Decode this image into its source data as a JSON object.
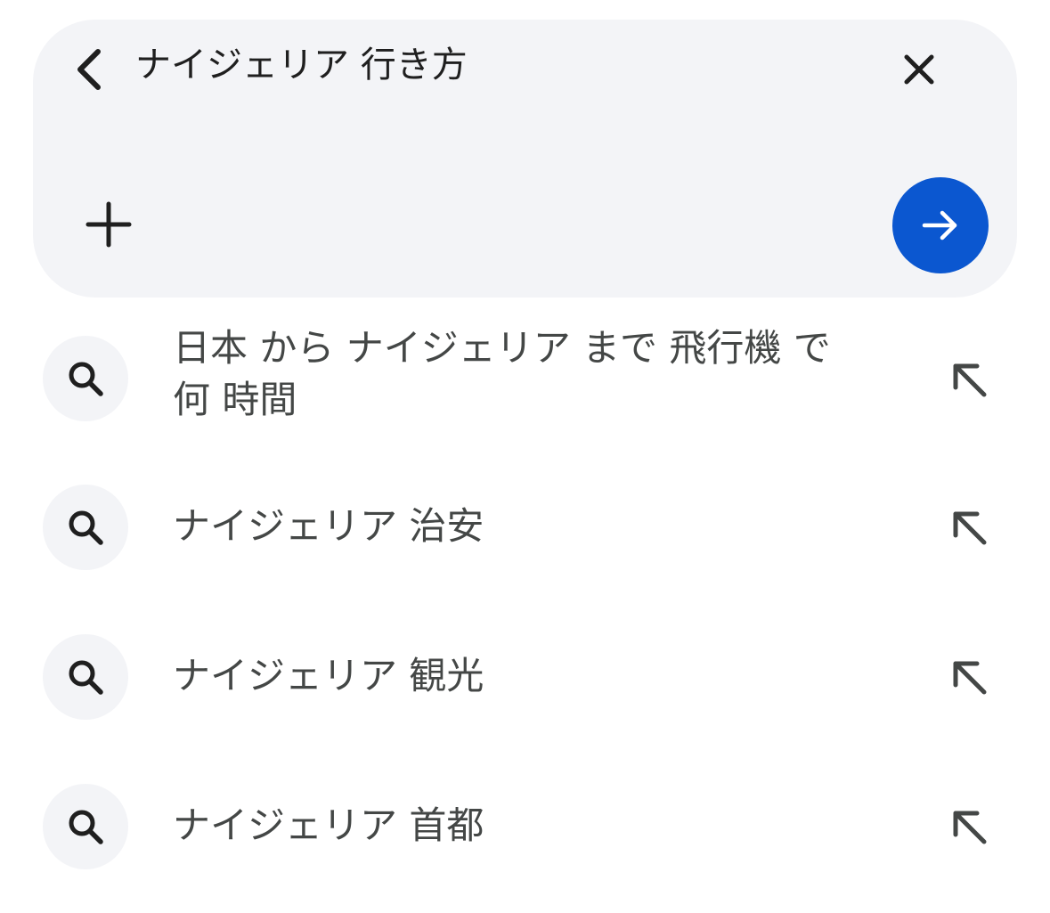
{
  "search_box": {
    "query": "ナイジェリア 行き方"
  },
  "suggestions": [
    {
      "text": "日本 から ナイジェリア まで 飛行機 で 何 時間"
    },
    {
      "text": "ナイジェリア 治安"
    },
    {
      "text": "ナイジェリア 観光"
    },
    {
      "text": "ナイジェリア 首都"
    }
  ],
  "colors": {
    "card_background": "#f3f4f7",
    "accent": "#0b57d0",
    "text_primary": "#1f1f1f",
    "text_secondary": "#444746"
  },
  "icons": {
    "back": "chevron-left-icon",
    "clear": "close-icon",
    "add": "plus-icon",
    "submit": "arrow-right-icon",
    "suggestion": "search-icon",
    "fill": "arrow-up-left-icon"
  }
}
